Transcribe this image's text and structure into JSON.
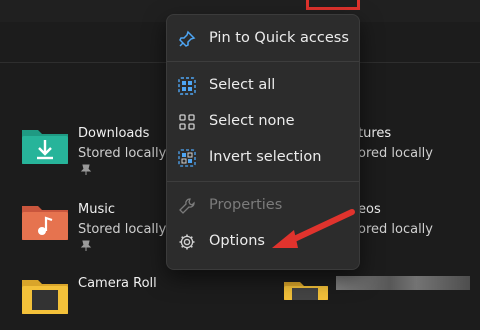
{
  "colors": {
    "background": "#1c1c1c",
    "menu_bg": "#2c2c2c",
    "accent_blue": "#4ea6f5",
    "highlight_red": "#e0332d",
    "folder_teal": "#27b49a",
    "folder_orange": "#e6734f",
    "folder_yellow": "#f3c13a"
  },
  "items_left": [
    {
      "name": "Downloads",
      "status": "Stored locally",
      "pinned": true,
      "icon": "downloads-folder-icon"
    },
    {
      "name": "Music",
      "status": "Stored locally",
      "pinned": true,
      "icon": "music-folder-icon"
    },
    {
      "name": "Camera Roll",
      "status": "",
      "icon": "camera-roll-folder-icon"
    }
  ],
  "items_right": [
    {
      "name": "tures",
      "status": "ored locally"
    },
    {
      "name": "eos",
      "status": "ored locally"
    }
  ],
  "menu": {
    "items": [
      {
        "label": "Pin to Quick access",
        "icon": "pin-icon",
        "enabled": true
      },
      {
        "label": "Select all",
        "icon": "select-all-icon",
        "enabled": true
      },
      {
        "label": "Select none",
        "icon": "select-none-icon",
        "enabled": true
      },
      {
        "label": "Invert selection",
        "icon": "invert-selection-icon",
        "enabled": true
      },
      {
        "label": "Properties",
        "icon": "wrench-icon",
        "enabled": false
      },
      {
        "label": "Options",
        "icon": "gear-icon",
        "enabled": true
      }
    ]
  }
}
